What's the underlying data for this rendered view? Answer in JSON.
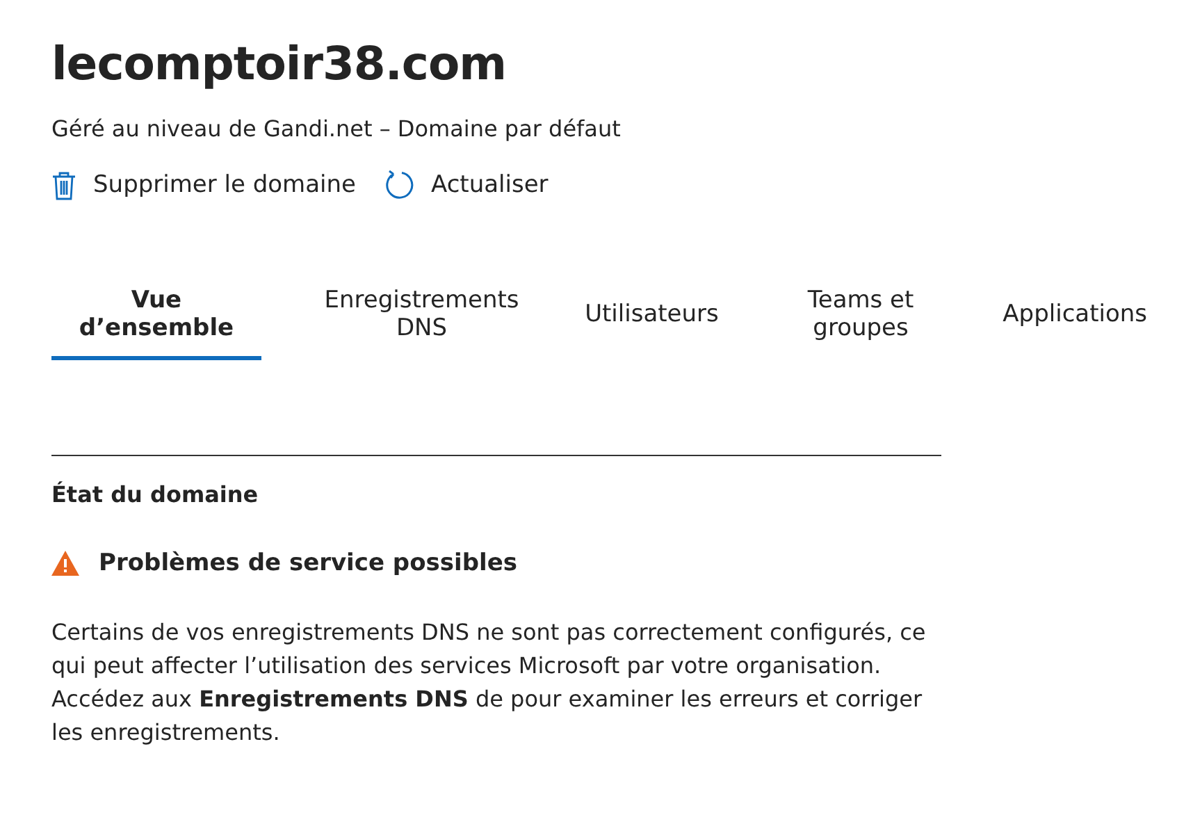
{
  "title": "lecomptoir38.com",
  "subtitle": "Géré au niveau de Gandi.net – Domaine par défaut",
  "actions": [
    {
      "kind": "delete",
      "label": "Supprimer le domaine"
    },
    {
      "kind": "refresh",
      "label": "Actualiser"
    }
  ],
  "tabs": [
    {
      "label": "Vue d’ensemble",
      "selected": true
    },
    {
      "label": "Enregistrements DNS",
      "selected": false
    },
    {
      "label": "Utilisateurs",
      "selected": false
    },
    {
      "label": "Teams et groupes",
      "selected": false
    },
    {
      "label": "Applications",
      "selected": false
    }
  ],
  "status": {
    "heading": "État du domaine",
    "warning": "Problèmes de service possibles",
    "message": "Certains de vos enregistrements DNS ne sont pas correctement configurés, ce qui peut affecter l’utilisation des services Microsoft par votre organisation. Accédez aux **Enregistrements DNS** de pour examiner les erreurs et corriger les enregistrements."
  }
}
